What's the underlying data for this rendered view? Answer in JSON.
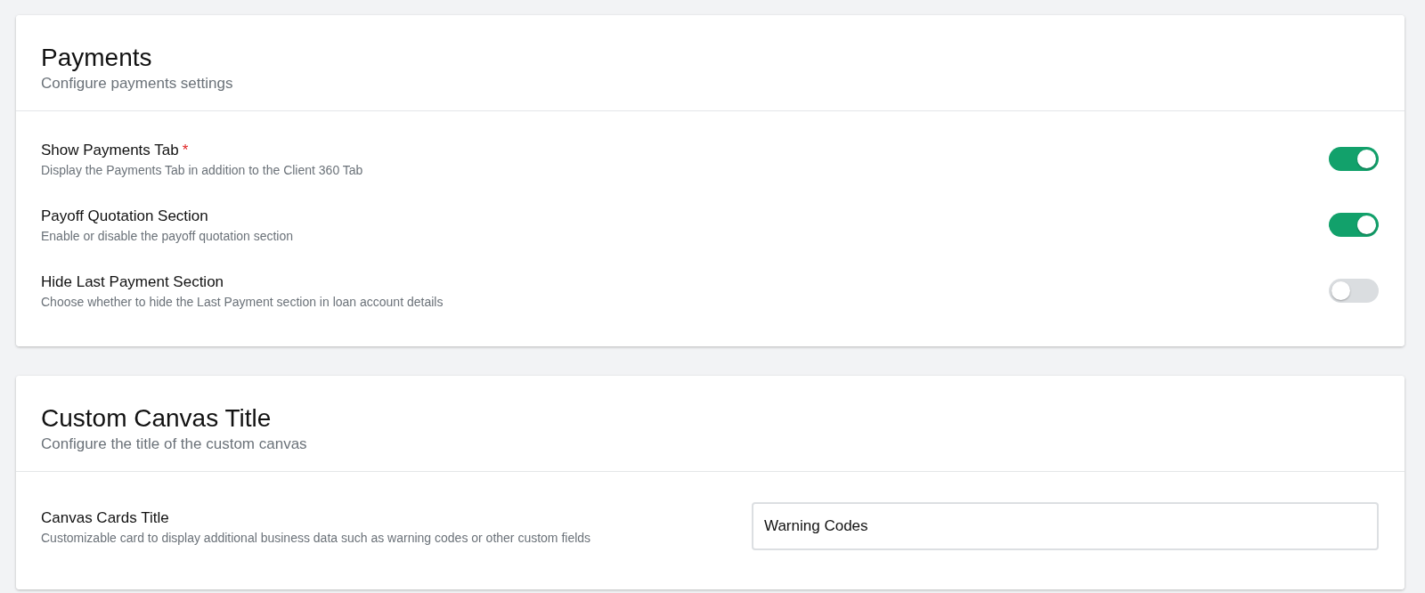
{
  "cards": [
    {
      "title": "Payments",
      "subtitle": "Configure payments settings",
      "rows": [
        {
          "kind": "toggle",
          "label": "Show Payments Tab",
          "required_mark": "*",
          "description": "Display the Payments Tab in addition to the Client 360 Tab",
          "on": true
        },
        {
          "kind": "toggle",
          "label": "Payoff Quotation Section",
          "description": "Enable or disable the payoff quotation section",
          "on": true
        },
        {
          "kind": "toggle",
          "label": "Hide Last Payment Section",
          "description": "Choose whether to hide the Last Payment section in loan account details",
          "on": false
        }
      ]
    },
    {
      "title": "Custom Canvas Title",
      "subtitle": "Configure the title of the custom canvas",
      "rows": [
        {
          "kind": "text",
          "label": "Canvas Cards Title",
          "description": "Customizable card to display additional business data such as warning codes or other custom fields",
          "value": "Warning Codes"
        }
      ]
    }
  ]
}
